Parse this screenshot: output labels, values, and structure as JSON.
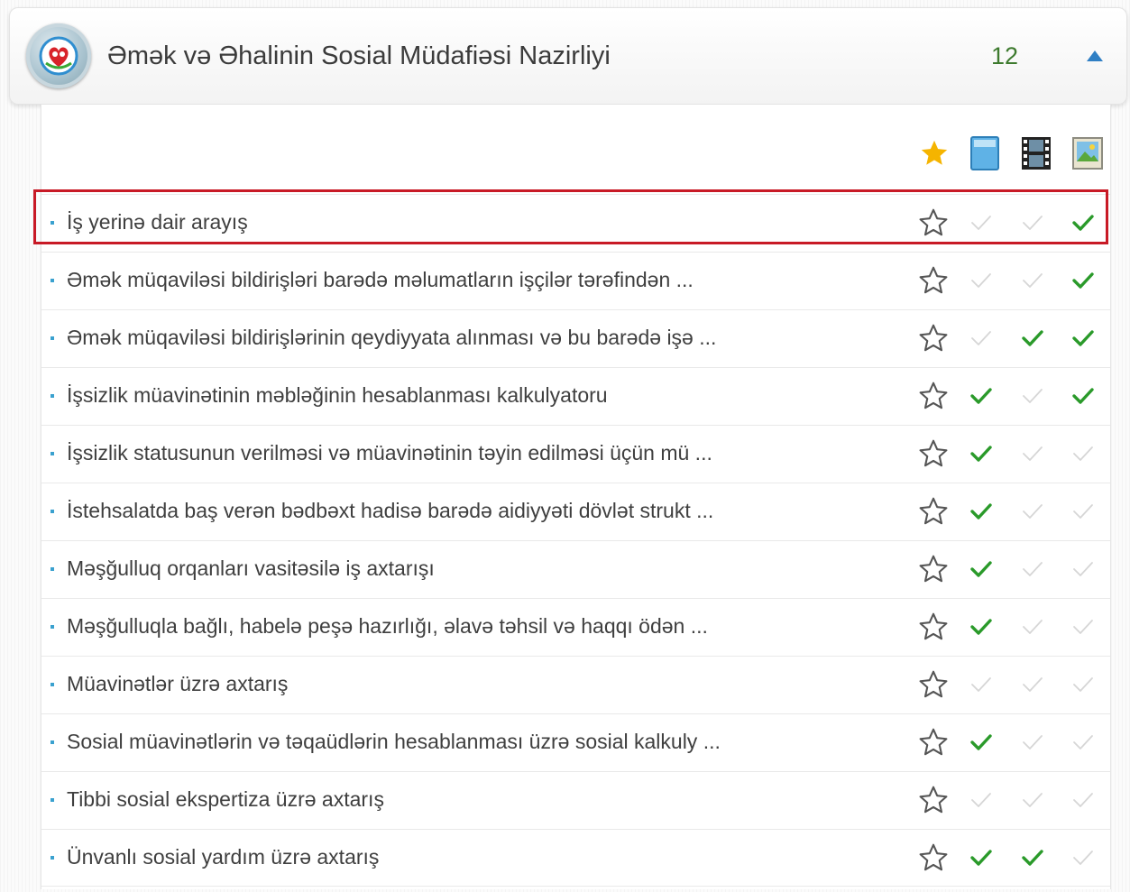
{
  "header": {
    "title": "Əmək və Əhalinin Sosial Müdafiəsi Nazirliyi",
    "count": "12",
    "toggle_icon": "triangle-up-icon"
  },
  "filter_icons": [
    "star-icon",
    "document-icon",
    "film-icon",
    "image-icon"
  ],
  "colors": {
    "check_on": "#2a9a2a",
    "check_off": "#d6d6d6",
    "highlight": "#c81a26",
    "star_filled": "#f5b400",
    "bullet": "#3aa1cf"
  },
  "services": [
    {
      "label": "İş yerinə dair arayış",
      "checks": [
        false,
        false,
        true
      ]
    },
    {
      "label": "Əmək müqaviləsi bildirişləri barədə məlumatların işçilər tərəfindən ...",
      "checks": [
        false,
        false,
        true
      ]
    },
    {
      "label": "Əmək müqaviləsi bildirişlərinin qeydiyyata alınması və bu barədə işə ...",
      "checks": [
        false,
        true,
        true
      ]
    },
    {
      "label": "İşsizlik müavinətinin məbləğinin hesablanması kalkulyatoru",
      "checks": [
        true,
        false,
        true
      ]
    },
    {
      "label": "İşsizlik statusunun verilməsi və müavinətinin təyin edilməsi üçün mü ...",
      "checks": [
        true,
        false,
        false
      ]
    },
    {
      "label": "İstehsalatda baş verən bədbəxt hadisə barədə aidiyyəti dövlət strukt ...",
      "checks": [
        true,
        false,
        false
      ]
    },
    {
      "label": "Məşğulluq orqanları vasitəsilə iş axtarışı",
      "checks": [
        true,
        false,
        false
      ]
    },
    {
      "label": "Məşğulluqla bağlı, habelə peşə hazırlığı, əlavə təhsil və haqqı ödən ...",
      "checks": [
        true,
        false,
        false
      ]
    },
    {
      "label": "Müavinətlər üzrə axtarış",
      "checks": [
        false,
        false,
        false
      ]
    },
    {
      "label": "Sosial müavinətlərin və təqaüdlərin hesablanması üzrə sosial kalkuly ...",
      "checks": [
        true,
        false,
        false
      ]
    },
    {
      "label": "Tibbi sosial ekspertiza üzrə axtarış",
      "checks": [
        false,
        false,
        false
      ]
    },
    {
      "label": "Ünvanlı sosial yardım üzrə axtarış",
      "checks": [
        true,
        true,
        false
      ]
    }
  ]
}
